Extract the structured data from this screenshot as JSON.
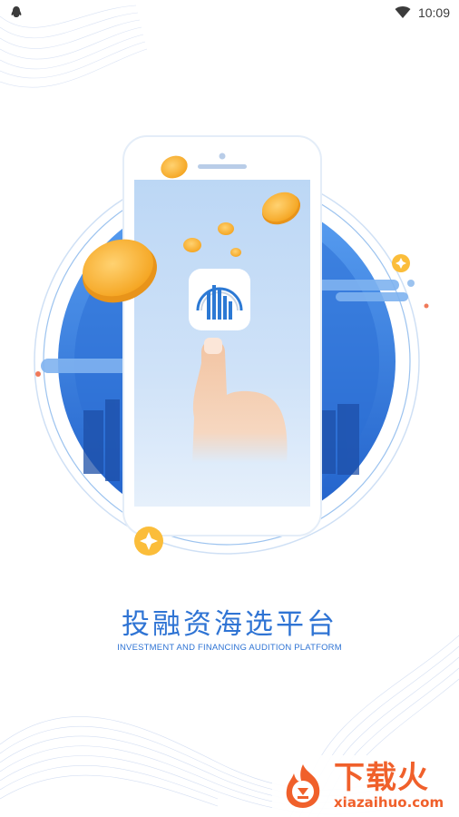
{
  "status_bar": {
    "time": "10:09",
    "left_icon": "qq-penguin-icon",
    "right_icon": "wifi-icon"
  },
  "splash": {
    "title": "投融资海选平台",
    "subtitle": "INVESTMENT AND FINANCING AUDITION PLATFORM",
    "accent_color": "#2f74d4",
    "illustration_icons": [
      "phone-icon",
      "finger-icon",
      "coin-icon",
      "sparkle-icon",
      "app-logo-icon",
      "city-skyline-icon"
    ]
  },
  "watermark": {
    "name": "下载火",
    "url": "xiazaihuo.com",
    "color": "#f0602b"
  }
}
